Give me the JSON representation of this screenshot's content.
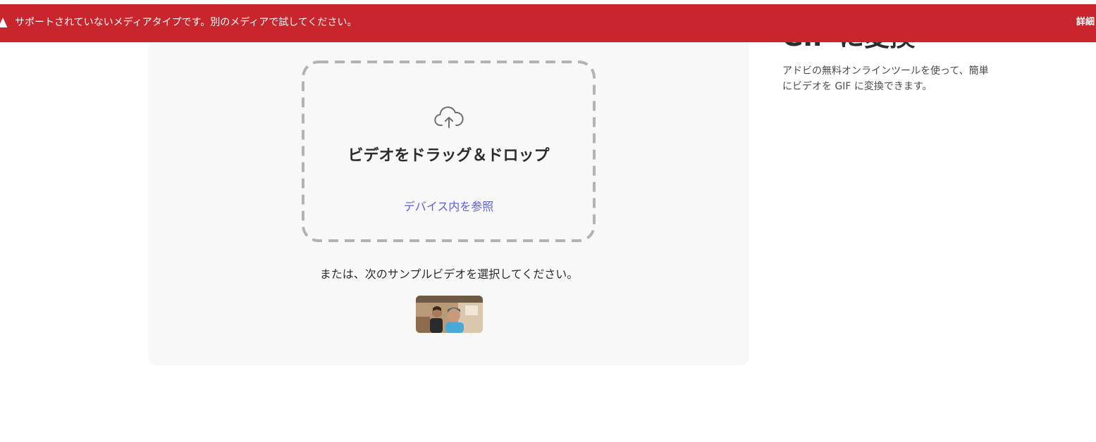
{
  "toast": {
    "message": "サポートされていないメディアタイプです。別のメディアで試してください。",
    "details_label": "詳細",
    "icon": "warning-icon",
    "color": "#c9252c"
  },
  "upload": {
    "icon": "cloud-upload-icon",
    "title": "ビデオをドラッグ＆ドロップ",
    "browse_label": "デバイス内を参照",
    "link_color": "#5c5ce0"
  },
  "samples": {
    "prompt": "または、次のサンプルビデオを選択してください。",
    "thumbnail": "sample-video-thumbnail"
  },
  "sidebar": {
    "title": "GIF に変換",
    "description": "アドビの無料オンラインツールを使って、簡単にビデオを GIF に変換できます。"
  }
}
